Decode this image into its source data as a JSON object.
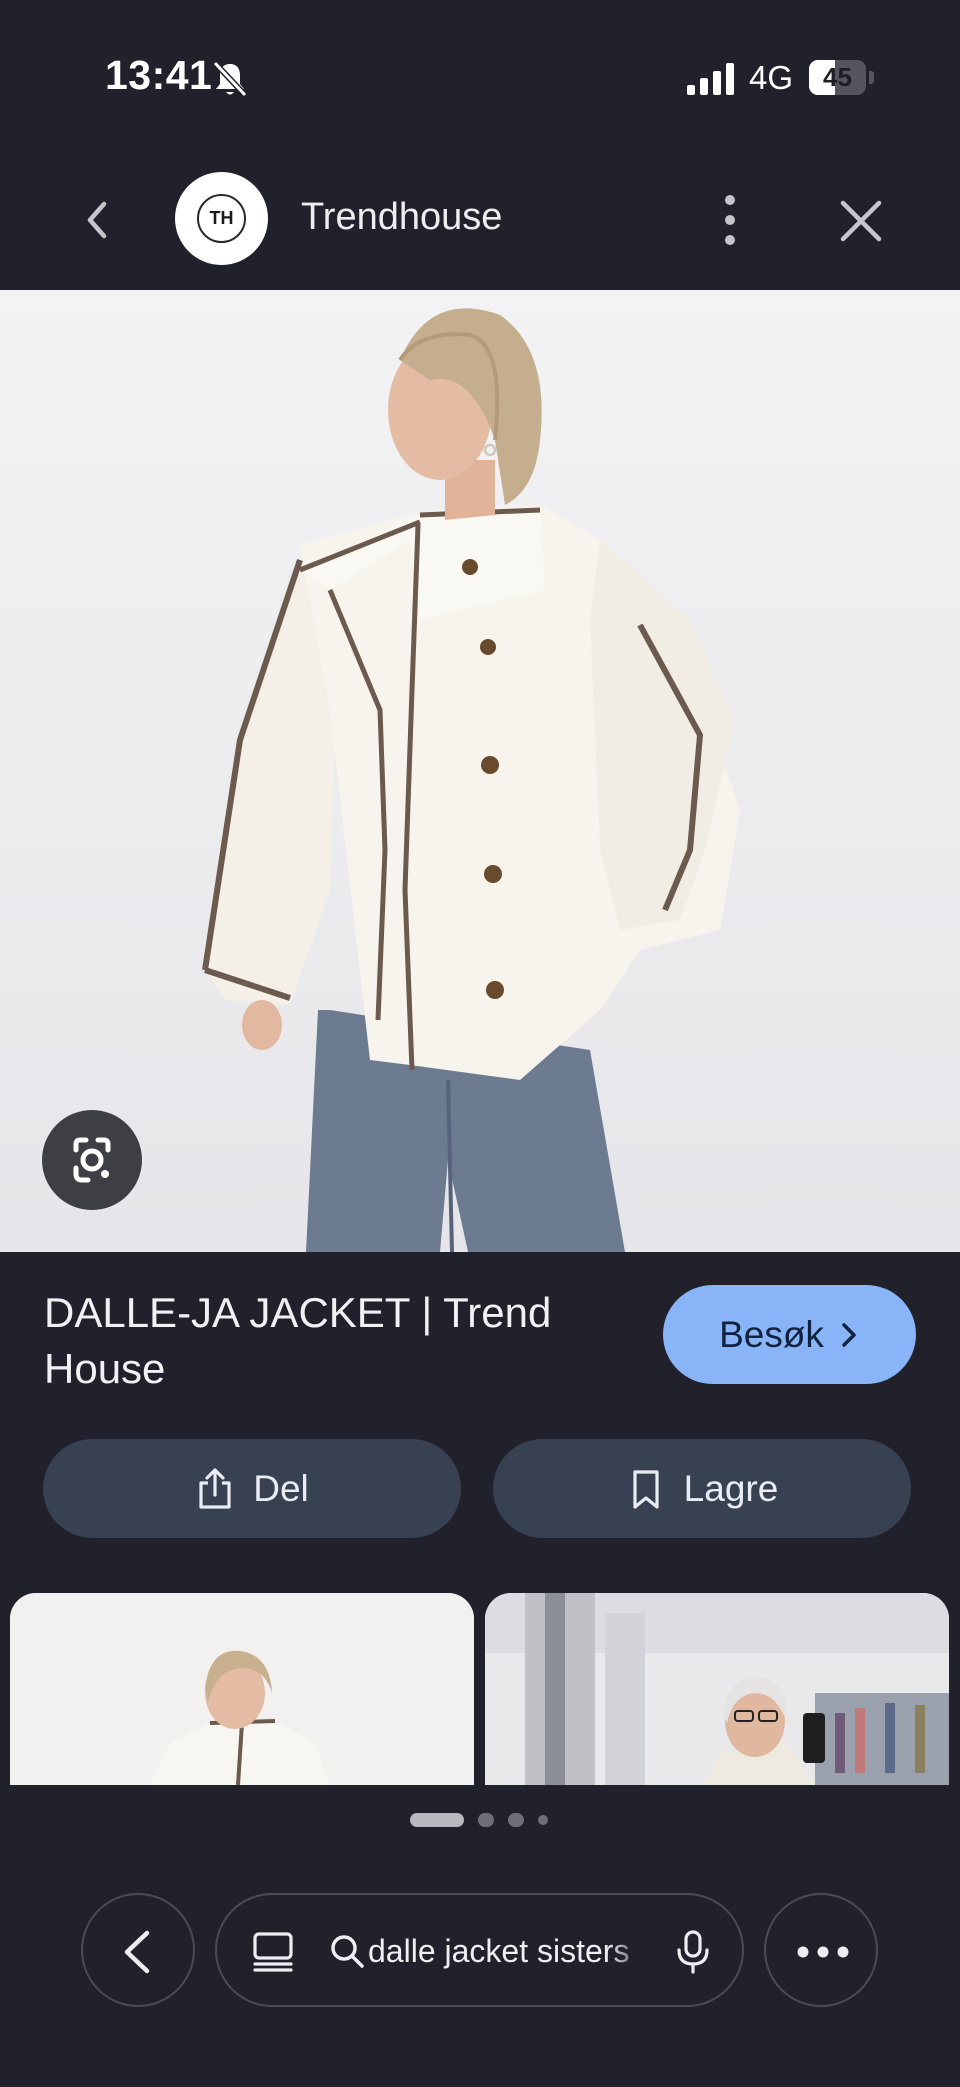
{
  "status_bar": {
    "time": "13:41",
    "network": "4G",
    "battery": "45",
    "battery_level": 0.45,
    "icons": [
      "bell-slash-icon",
      "signal-icon",
      "battery-icon"
    ]
  },
  "header": {
    "site_logo_text": "TH",
    "site_name": "Trendhouse",
    "icons": [
      "chevron-left-icon",
      "more-vertical-icon",
      "close-icon"
    ]
  },
  "main_image": {
    "icon": "google-lens-icon"
  },
  "result": {
    "title": "DALLE-JA JACKET | Trend House",
    "visit_label": "Besøk"
  },
  "actions": {
    "share_label": "Del",
    "save_label": "Lagre"
  },
  "pagination": {
    "total": 4,
    "active": 0
  },
  "toolbar": {
    "search_query": "dalle jacket sisters",
    "icons": [
      "back-icon",
      "tabs-icon",
      "search-icon",
      "mic-icon",
      "more-horizontal-icon"
    ]
  },
  "colors": {
    "background": "#20212a",
    "visit_button": "#8ab4f8",
    "action_button": "#374151"
  }
}
